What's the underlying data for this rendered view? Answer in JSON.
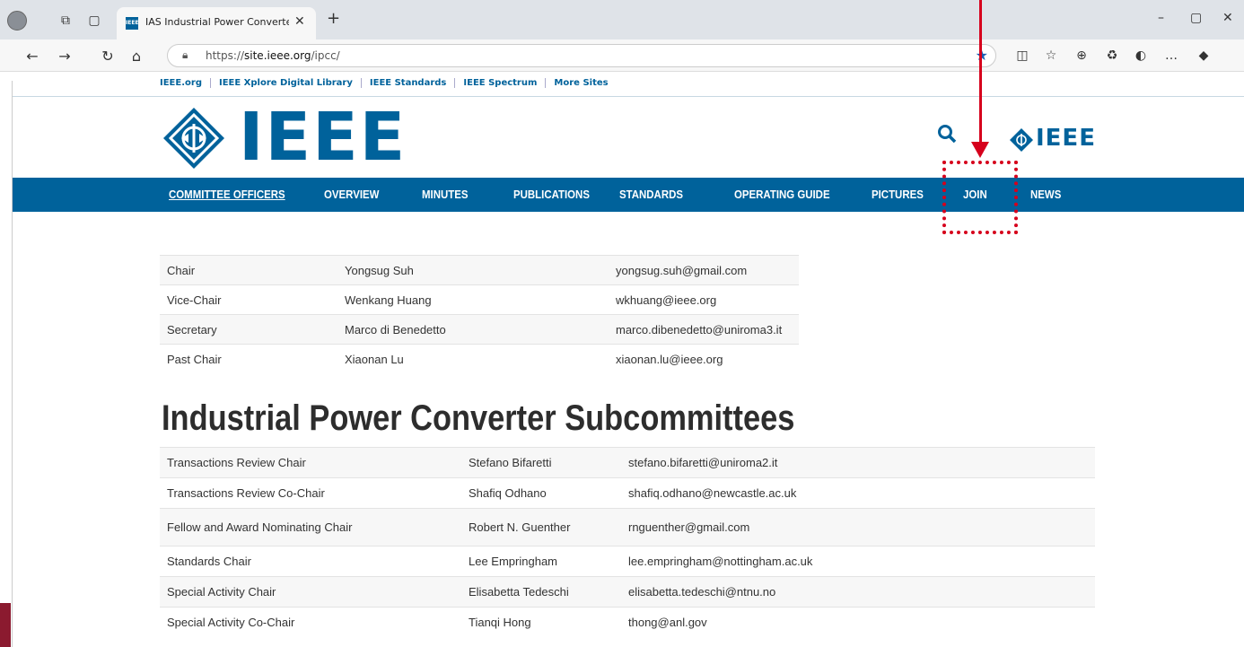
{
  "browser": {
    "tab_title": "IAS Industrial Power Converters C",
    "tab_favicon": "IEEE",
    "url_prefix": "https://",
    "url_domain": "site.ieee.org",
    "url_path": "/ipcc/"
  },
  "top_links": [
    "IEEE.org",
    "IEEE Xplore Digital Library",
    "IEEE Standards",
    "IEEE Spectrum",
    "More Sites"
  ],
  "logo_text": "IEEE",
  "small_logo_text": "IEEE",
  "nav": {
    "items": [
      {
        "label": "COMMITTEE OFFICERS"
      },
      {
        "label": "OVERVIEW"
      },
      {
        "label": "MINUTES"
      },
      {
        "label": "PUBLICATIONS"
      },
      {
        "label": "STANDARDS"
      },
      {
        "label": "OPERATING GUIDE"
      },
      {
        "label": "PICTURES"
      },
      {
        "label": "JOIN"
      },
      {
        "label": "NEWS"
      }
    ]
  },
  "officers": [
    {
      "role": "Chair",
      "name": "Yongsug Suh",
      "email": "yongsug.suh@gmail.com"
    },
    {
      "role": "Vice-Chair",
      "name": "Wenkang Huang",
      "email": "wkhuang@ieee.org"
    },
    {
      "role": "Secretary",
      "name": "Marco di Benedetto",
      "email": "marco.dibenedetto@uniroma3.it"
    },
    {
      "role": "Past Chair",
      "name": "Xiaonan Lu",
      "email": "xiaonan.lu@ieee.org"
    }
  ],
  "subcommittees_heading": "Industrial Power Converter Subcommittees",
  "subcommittees": [
    {
      "role": "Transactions Review Chair",
      "name": "Stefano Bifaretti",
      "email": "stefano.bifaretti@uniroma2.it"
    },
    {
      "role": "Transactions Review Co-Chair",
      "name": "Shafiq Odhano",
      "email": "shafiq.odhano@newcastle.ac.uk"
    },
    {
      "role": "Fellow and Award Nominating Chair",
      "name": "Robert N. Guenther",
      "email": "rnguenther@gmail.com"
    },
    {
      "role": "Standards Chair",
      "name": "Lee Empringham",
      "email": "lee.empringham@nottingham.ac.uk"
    },
    {
      "role": "Special Activity Chair",
      "name": "Elisabetta Tedeschi",
      "email": "elisabetta.tedeschi@ntnu.no"
    },
    {
      "role": "Special Activity Co-Chair",
      "name": "Tianqi Hong",
      "email": "thong@anl.gov"
    }
  ],
  "colors": {
    "brand": "#00629b",
    "callout": "#d6001c"
  }
}
